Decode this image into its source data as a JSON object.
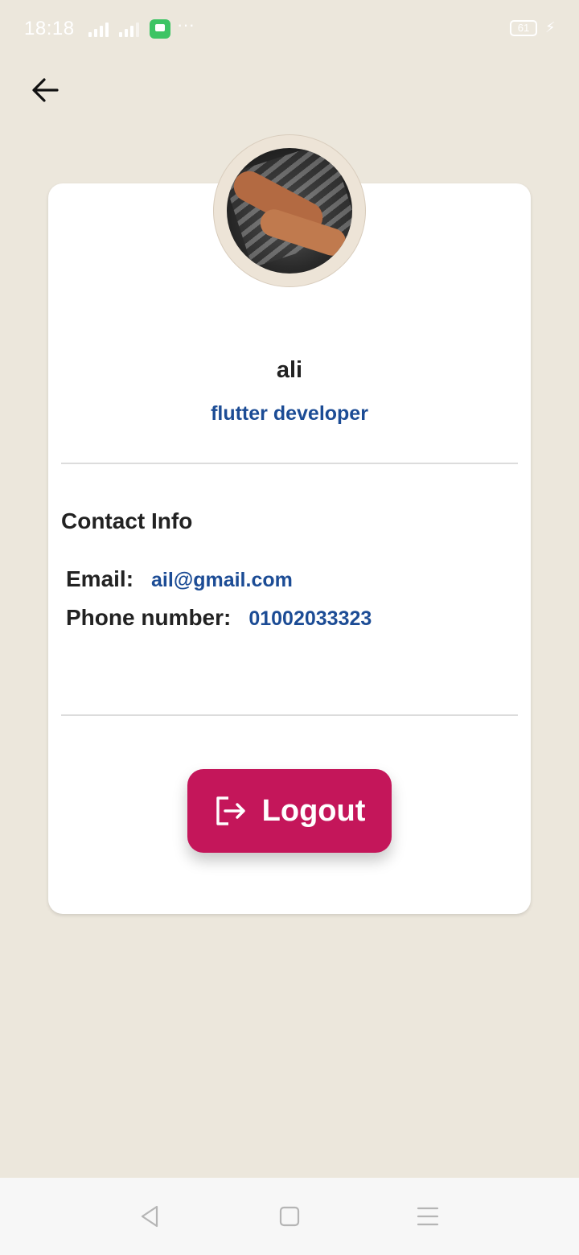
{
  "status_bar": {
    "time": "18:18",
    "dots": "···",
    "battery": "61"
  },
  "profile": {
    "name": "ali",
    "role": "flutter developer"
  },
  "contact": {
    "heading": "Contact Info",
    "email_label": "Email:",
    "email_value": "ail@gmail.com",
    "phone_label": "Phone number:",
    "phone_value": "01002033323"
  },
  "logout": {
    "label": "Logout"
  },
  "colors": {
    "background": "#ECE7DC",
    "card": "#FFFFFF",
    "accent_blue": "#1C4C95",
    "logout_button": "#C4165A",
    "text_dark": "#222222"
  },
  "icons": {
    "back": "arrow-left-icon",
    "logout": "logout-icon",
    "nav_back": "triangle-back-icon",
    "nav_home": "square-home-icon",
    "nav_menu": "menu-lines-icon"
  }
}
